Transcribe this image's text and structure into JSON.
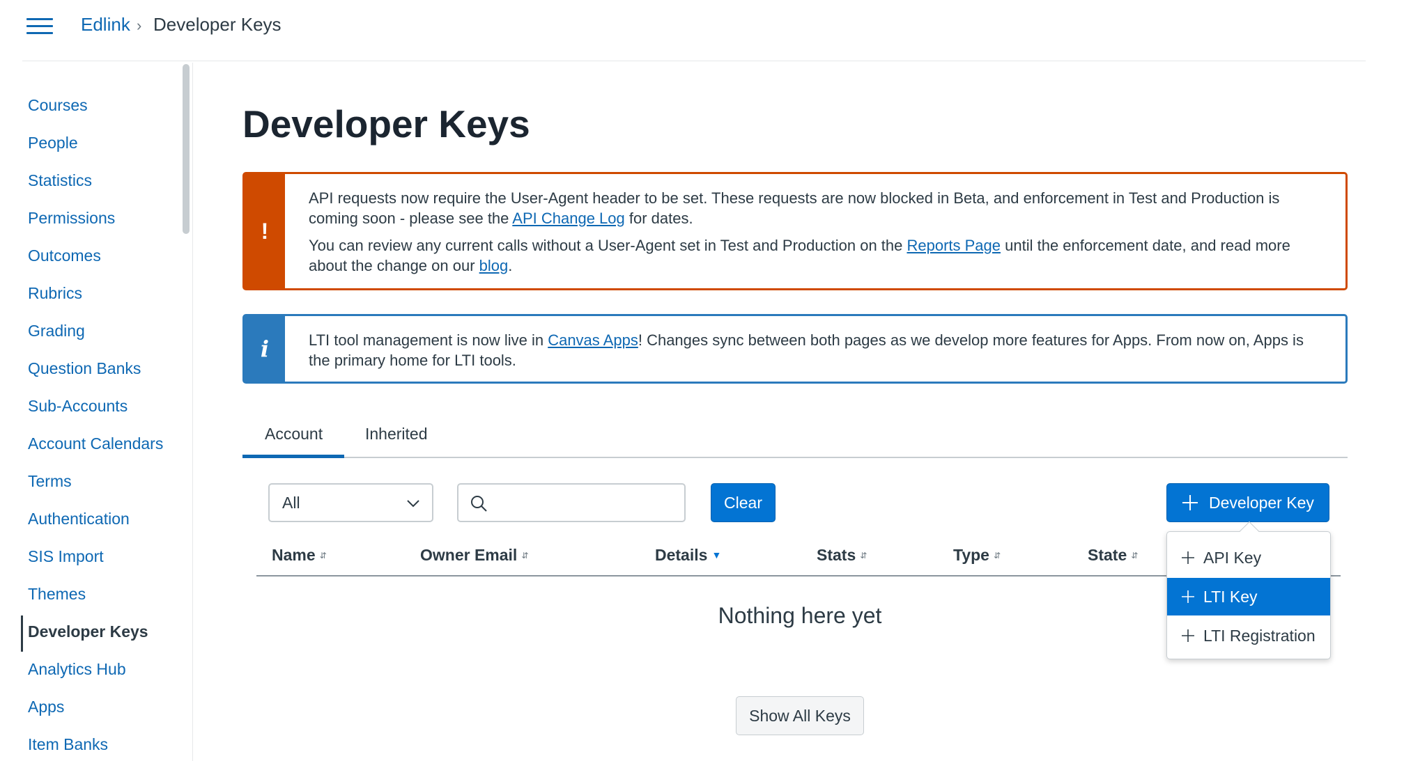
{
  "header": {
    "breadcrumb_root": "Edlink",
    "breadcrumb_separator": "›",
    "breadcrumb_current": "Developer Keys"
  },
  "sidebar": {
    "items": [
      {
        "label": "Courses"
      },
      {
        "label": "People"
      },
      {
        "label": "Statistics"
      },
      {
        "label": "Permissions"
      },
      {
        "label": "Outcomes"
      },
      {
        "label": "Rubrics"
      },
      {
        "label": "Grading"
      },
      {
        "label": "Question Banks"
      },
      {
        "label": "Sub-Accounts"
      },
      {
        "label": "Account Calendars"
      },
      {
        "label": "Terms"
      },
      {
        "label": "Authentication"
      },
      {
        "label": "SIS Import"
      },
      {
        "label": "Themes"
      },
      {
        "label": "Developer Keys",
        "active": true
      },
      {
        "label": "Analytics Hub"
      },
      {
        "label": "Apps"
      },
      {
        "label": "Item Banks"
      }
    ]
  },
  "main": {
    "title": "Developer Keys",
    "warning_alert": {
      "icon": "!",
      "p1_text_a": "API requests now require the User-Agent header to be set. These requests are now blocked in Beta, and enforcement in Test and Production is coming soon - please see the ",
      "p1_link": "API Change Log",
      "p1_text_b": " for dates.",
      "p2_text_a": "You can review any current calls without a User-Agent set in Test and Production on the ",
      "p2_link1": "Reports Page",
      "p2_text_b": " until the enforcement date, and read more about the change on our ",
      "p2_link2": "blog",
      "p2_text_c": "."
    },
    "info_alert": {
      "icon": "i",
      "text_a": "LTI tool management is now live in ",
      "link": "Canvas Apps",
      "text_b": "! Changes sync between both pages as we develop more features for Apps. From now on, Apps is the primary home for LTI tools."
    },
    "tabs": [
      {
        "label": "Account",
        "selected": true
      },
      {
        "label": "Inherited",
        "selected": false
      }
    ],
    "filter": {
      "selected": "All"
    },
    "search": {
      "value": "",
      "placeholder": ""
    },
    "clear_label": "Clear",
    "add_button_label": "Developer Key",
    "table": {
      "columns": [
        {
          "label": "Name",
          "sort": "none"
        },
        {
          "label": "Owner Email",
          "sort": "none"
        },
        {
          "label": "Details",
          "sort": "desc"
        },
        {
          "label": "Stats",
          "sort": "none"
        },
        {
          "label": "Type",
          "sort": "none"
        },
        {
          "label": "State",
          "sort": "none"
        }
      ],
      "empty_message": "Nothing here yet"
    },
    "show_all_label": "Show All Keys",
    "add_menu": {
      "items": [
        {
          "label": "API Key",
          "highlighted": false
        },
        {
          "label": "LTI Key",
          "highlighted": true
        },
        {
          "label": "LTI Registration",
          "highlighted": false
        }
      ]
    }
  },
  "colors": {
    "link": "#0e68b3",
    "primary_button": "#0374d3",
    "warning": "#cf4a00",
    "info": "#2b7abc",
    "title": "#1b2530"
  }
}
